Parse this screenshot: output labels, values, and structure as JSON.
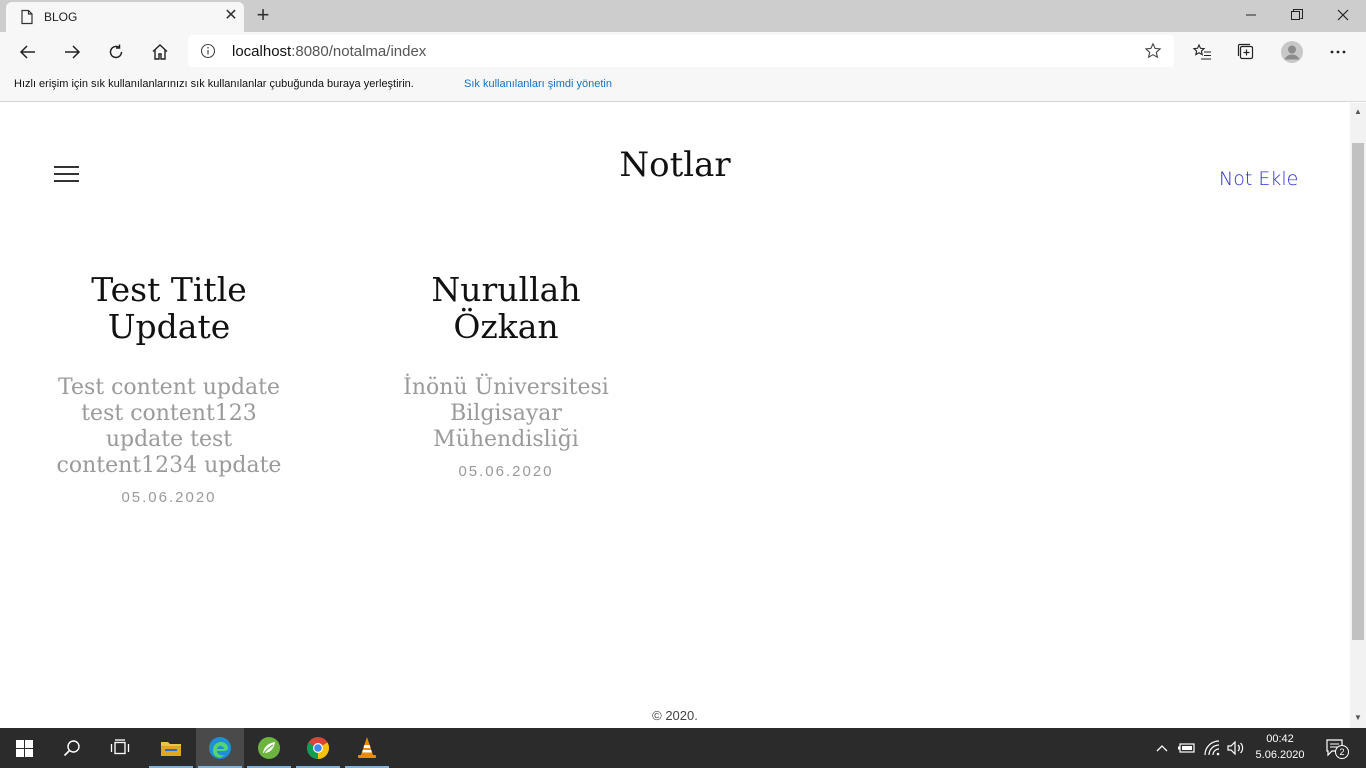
{
  "browser": {
    "tab_title": "BLOG",
    "url_host": "localhost",
    "url_rest": ":8080/notalma/index",
    "favorites_prompt": "Hızlı erişim için sık kullanılanlarınızı sık kullanılanlar çubuğunda buraya yerleştirin.",
    "favorites_link": "Sık kullanılanları şimdi yönetin"
  },
  "page": {
    "title": "Notlar",
    "add_link": "Not Ekle",
    "footer": "© 2020."
  },
  "notes": [
    {
      "title_lines": [
        "Test Title",
        "Update"
      ],
      "content_lines": [
        "Test content update",
        "test content123",
        "update test",
        "content1234 update"
      ],
      "date": "05.06.2020"
    },
    {
      "title_lines": [
        "Nurullah",
        "Özkan"
      ],
      "content_lines": [
        "İnönü Üniversitesi",
        "Bilgisayar",
        "Mühendisliği"
      ],
      "date": "05.06.2020"
    }
  ],
  "taskbar": {
    "time": "00:42",
    "date": "5.06.2020",
    "notification_count": "2"
  }
}
